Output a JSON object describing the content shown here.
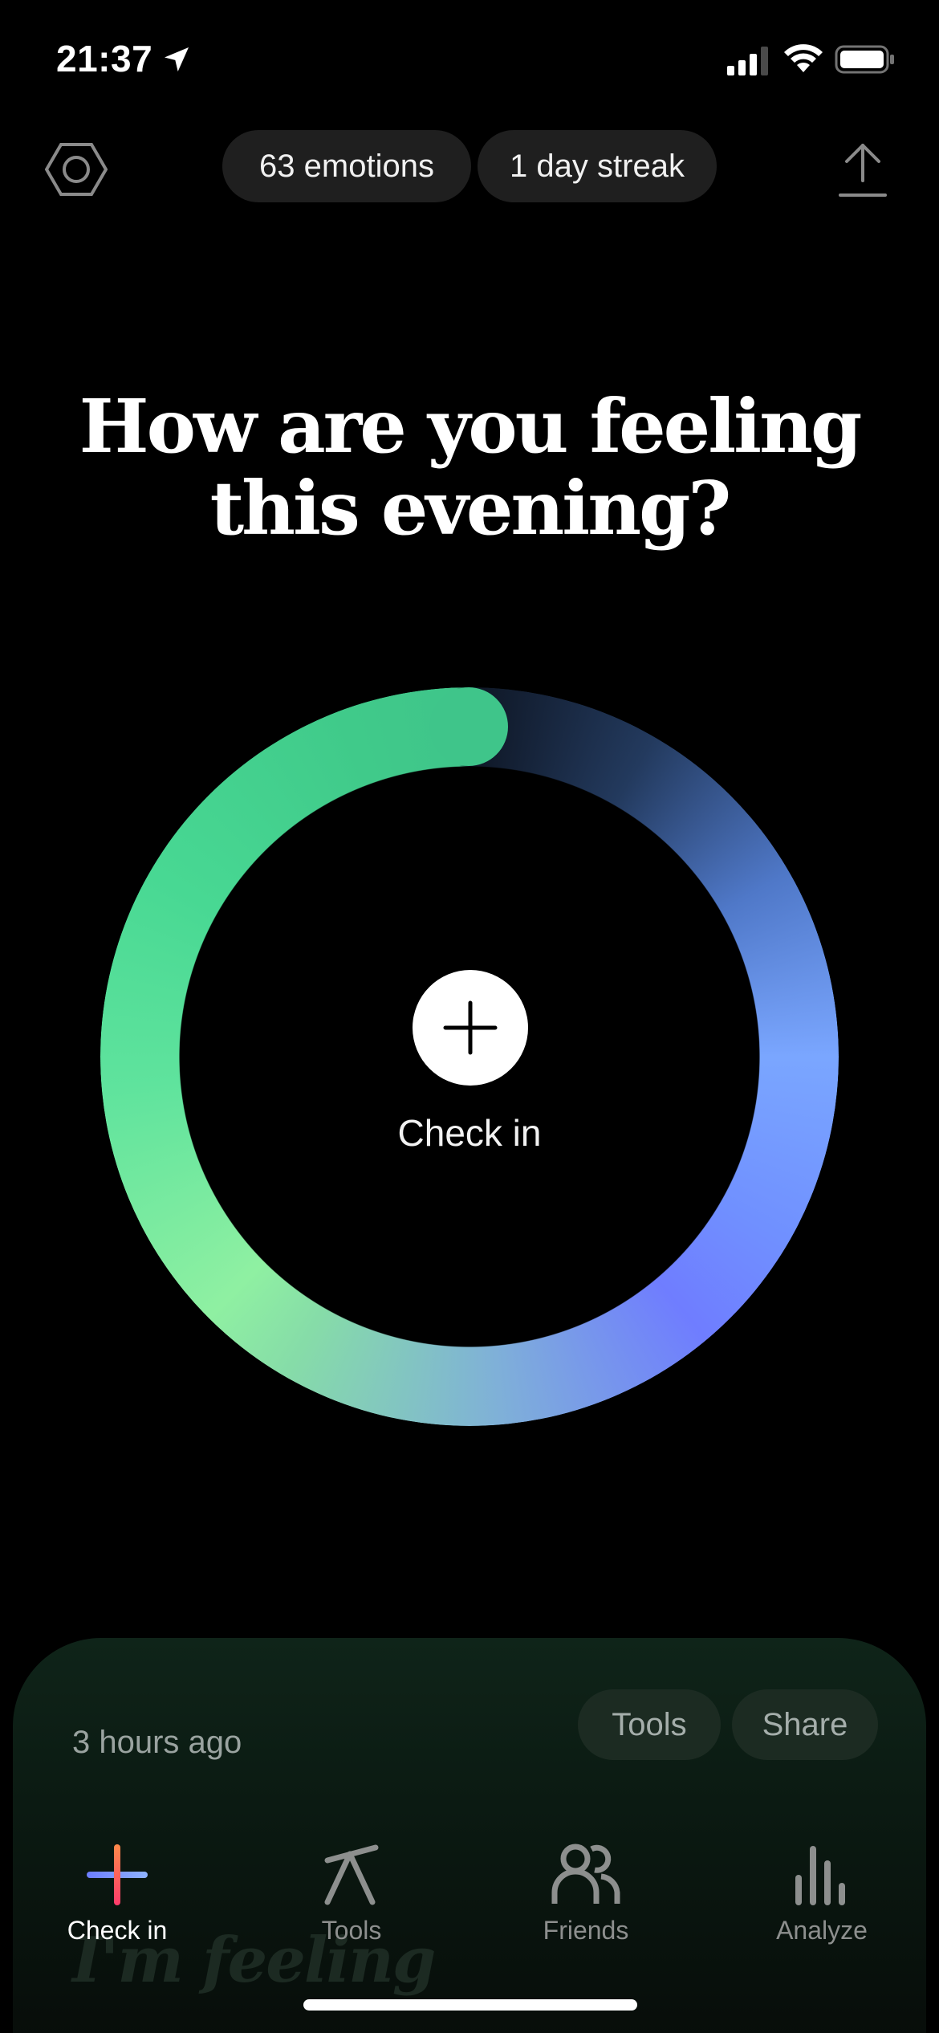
{
  "status_bar": {
    "time": "21:37"
  },
  "header": {
    "emotions_pill": "63 emotions",
    "streak_pill": "1 day streak"
  },
  "main": {
    "heading_line1": "How are you feeling",
    "heading_line2": "this evening?",
    "checkin_label": "Check in"
  },
  "bottom_card": {
    "time_ago": "3 hours ago",
    "tools_button": "Tools",
    "share_button": "Share",
    "preview_text": "I'm feeling"
  },
  "tab_bar": {
    "items": [
      {
        "label": "Check in",
        "icon": "plus-icon",
        "active": true
      },
      {
        "label": "Tools",
        "icon": "tools-icon",
        "active": false
      },
      {
        "label": "Friends",
        "icon": "friends-icon",
        "active": false
      },
      {
        "label": "Analyze",
        "icon": "analyze-icon",
        "active": false
      }
    ]
  },
  "colors": {
    "background": "#000000",
    "ring_green": "#3fc58a",
    "ring_blue": "#7aa6ff",
    "ring_violet": "#6f7dff",
    "pill_bg": "#1f1f1f"
  }
}
